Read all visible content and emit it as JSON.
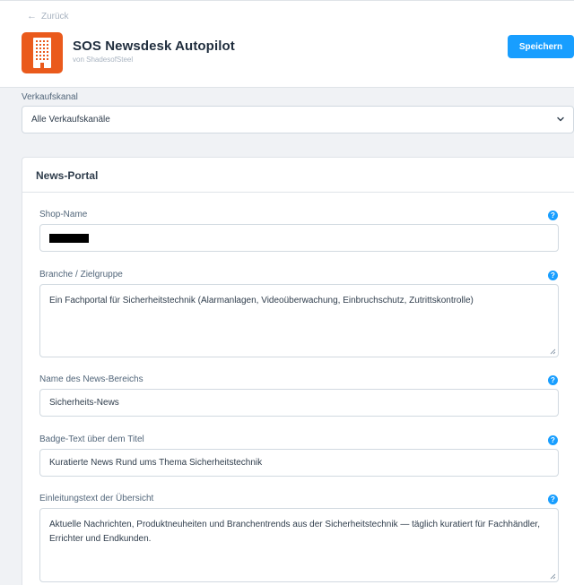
{
  "header": {
    "back_label": "Zurück",
    "app_title": "SOS Newsdesk Autopilot",
    "vendor": "von ShadesofSteel",
    "save_label": "Speichern",
    "app_icon_name": "building-icon",
    "brand_color": "#ea5a1c",
    "accent_color": "#189eff"
  },
  "channel": {
    "label": "Verkaufskanal",
    "selected": "Alle Verkaufskanäle"
  },
  "card": {
    "title": "News-Portal",
    "fields": [
      {
        "label": "Shop-Name",
        "value": "",
        "redacted": true
      },
      {
        "label": "Branche / Zielgruppe",
        "value": "Ein Fachportal für Sicherheitstechnik (Alarmanlagen, Videoüberwachung, Einbruchschutz, Zutrittskontrolle)"
      },
      {
        "label": "Name des News-Bereichs",
        "value": "Sicherheits-News"
      },
      {
        "label": "Badge-Text über dem Titel",
        "value": "Kuratierte News Rund ums Thema Sicherheitstechnik"
      },
      {
        "label": "Einleitungstext der Übersicht",
        "value": "Aktuelle Nachrichten, Produktneuheiten und Branchentrends aus der Sicherheitstechnik — täglich kuratiert für Fachhändler, Errichter und Endkunden."
      }
    ],
    "help_glyph": "?"
  }
}
